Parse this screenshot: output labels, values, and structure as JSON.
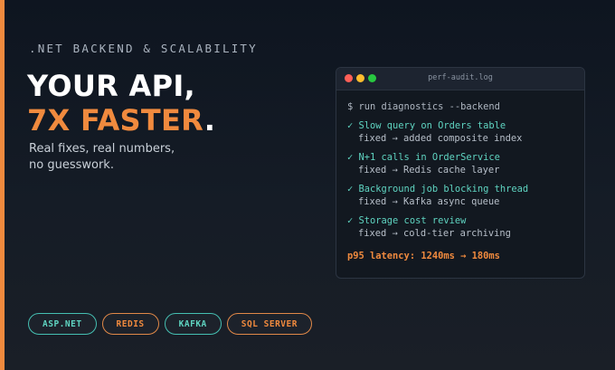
{
  "hero": {
    "eyebrow": ".NET BACKEND & SCALABILITY",
    "headline_line1": "YOUR API,",
    "headline_line2_accent": "7X FASTER",
    "headline_line2_tail": ".",
    "subtitle_line1": "Real fixes, real numbers,",
    "subtitle_line2": "no guesswork."
  },
  "terminal": {
    "title": "perf-audit.log",
    "command": "$ run diagnostics --backend",
    "entries": [
      {
        "title": "✓ Slow query on Orders table",
        "detail": "fixed → added composite index"
      },
      {
        "title": "✓ N+1 calls in OrderService",
        "detail": "fixed → Redis cache layer"
      },
      {
        "title": "✓ Background job blocking thread",
        "detail": "fixed → Kafka async queue"
      },
      {
        "title": "✓ Storage cost review",
        "detail": "fixed → cold-tier archiving"
      }
    ],
    "latency": "p95 latency: 1240ms → 180ms"
  },
  "tags": [
    "ASP.NET",
    "REDIS",
    "KAFKA",
    "SQL SERVER"
  ],
  "colors": {
    "accent": "#f08a3e",
    "teal": "#5fd4c1",
    "background": "#131a24"
  }
}
